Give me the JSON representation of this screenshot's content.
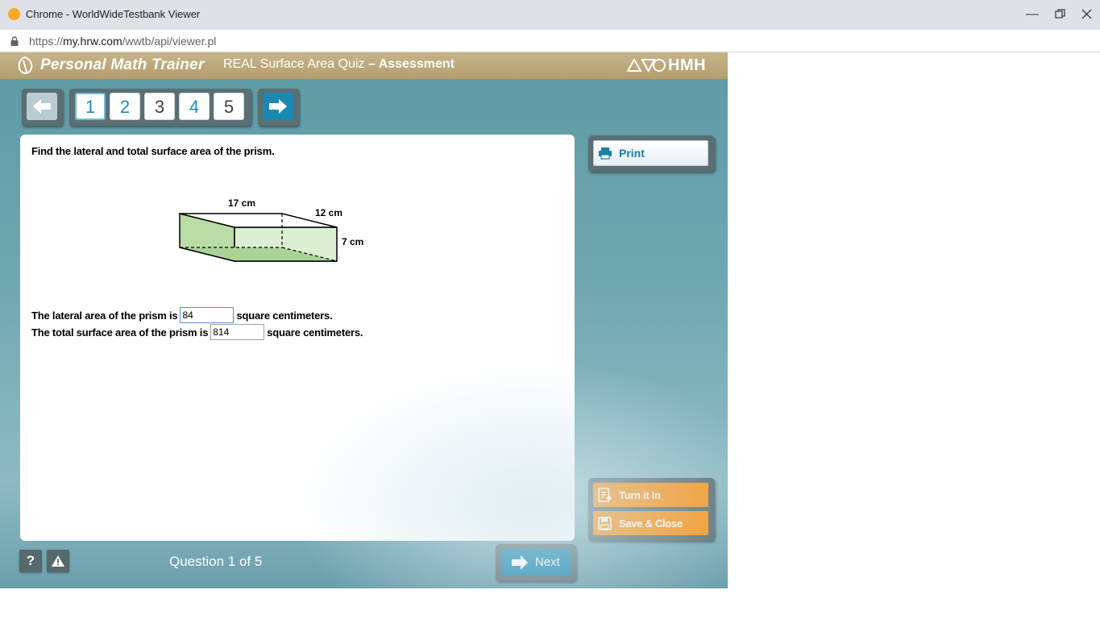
{
  "window": {
    "title": "Chrome - WorldWideTestbank Viewer",
    "url_scheme": "https://",
    "url_host": "my.hrw.com",
    "url_path": "/wwtb/api/viewer.pl"
  },
  "header": {
    "brand": "Personal Math Trainer",
    "quiz_title": "REAL Surface Area Quiz",
    "quiz_suffix": "– Assessment",
    "publisher": "HMH"
  },
  "nav": {
    "questions": [
      "1",
      "2",
      "3",
      "4",
      "5"
    ],
    "current_index": 0,
    "answered": [
      1,
      3
    ]
  },
  "question": {
    "prompt": "Find the lateral and total surface area of the prism.",
    "dims": {
      "length": "17 cm",
      "width": "12 cm",
      "height": "7 cm"
    },
    "lateral_prefix": "The lateral area of the prism is",
    "lateral_value": "84",
    "lateral_suffix": "square centimeters.",
    "total_prefix": "The total surface area of the prism is",
    "total_value": "814",
    "total_suffix": "square centimeters."
  },
  "sidebar": {
    "print_label": "Print",
    "turn_in_label": "Turn it In",
    "save_close_label": "Save & Close"
  },
  "footer": {
    "help_label": "?",
    "question_count": "Question 1 of 5",
    "next_label": "Next"
  },
  "colors": {
    "accent_blue": "#1a88b1",
    "orange": "#f7941d",
    "header_gold": "#b39e6d",
    "prism_green": "#b9dca6"
  },
  "icons": [
    "back-arrow-icon",
    "forward-arrow-icon",
    "printer-icon",
    "turn-in-icon",
    "save-icon",
    "help-icon",
    "warning-icon",
    "next-arrow-icon",
    "lock-icon"
  ]
}
